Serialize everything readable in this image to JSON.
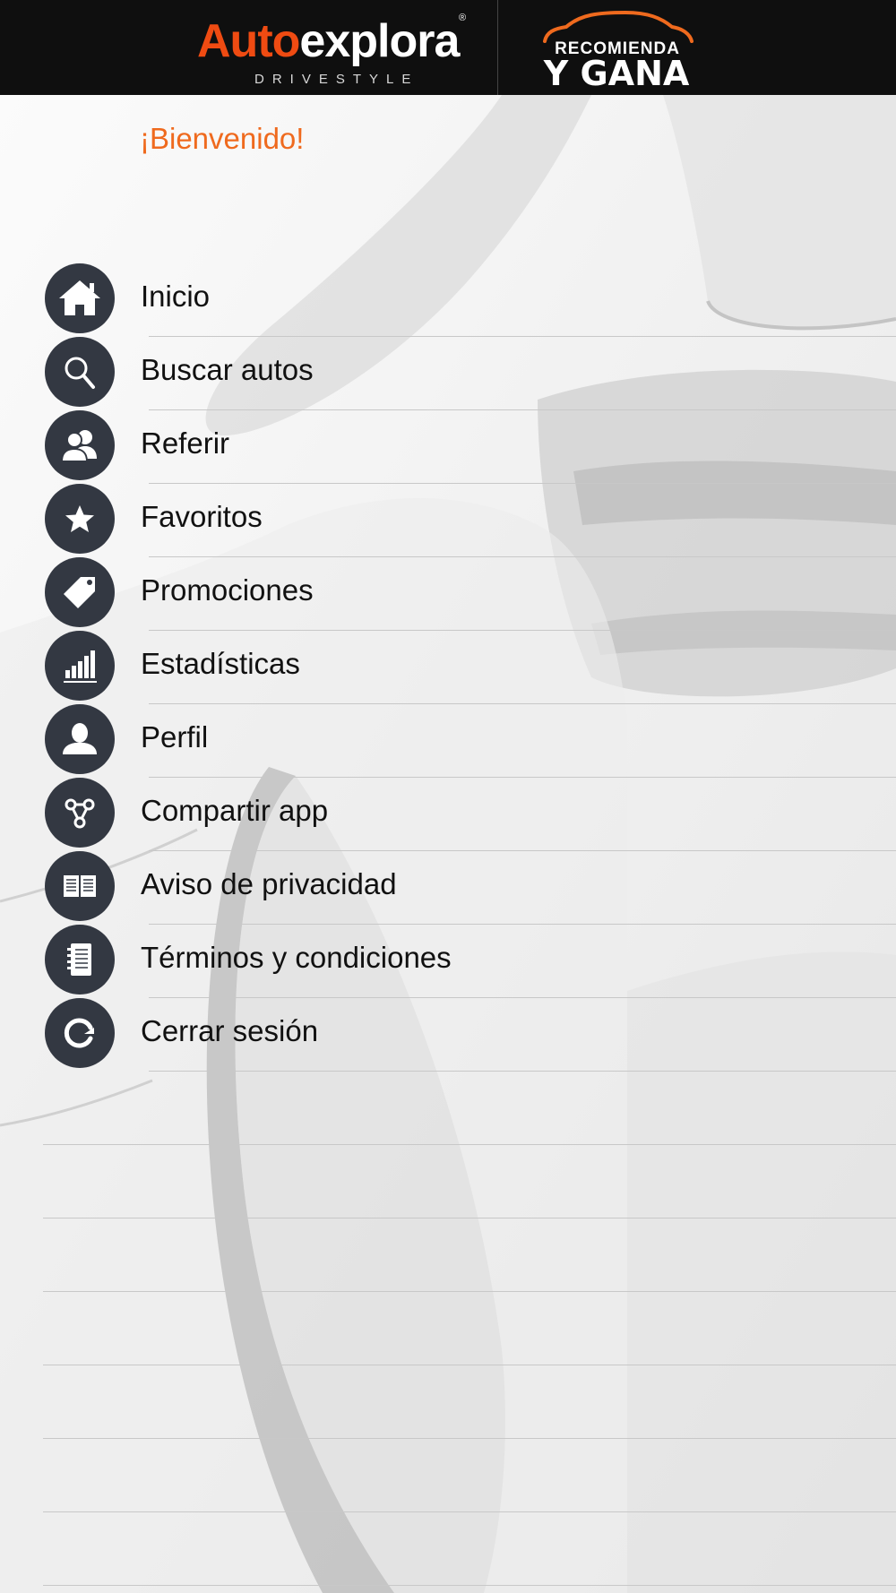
{
  "header": {
    "brand_part1": "Auto",
    "brand_part2": "explora",
    "brand_registered": "®",
    "brand_tagline": "DRIVESTYLE",
    "campaign_line1": "RECOMIENDA",
    "campaign_line2": "Y GANA",
    "background_color": "#0f0f0f",
    "accent_color": "#ef4b12"
  },
  "welcome": {
    "text": "¡Bienvenido!",
    "color": "#ef6a1e"
  },
  "menu": {
    "icon_color": "#333842",
    "items": [
      {
        "label": "Inicio",
        "icon": "home-icon"
      },
      {
        "label": "Buscar autos",
        "icon": "search-icon"
      },
      {
        "label": "Referir",
        "icon": "users-icon"
      },
      {
        "label": "Favoritos",
        "icon": "star-icon"
      },
      {
        "label": "Promociones",
        "icon": "tag-icon"
      },
      {
        "label": "Estadísticas",
        "icon": "bar-chart-icon"
      },
      {
        "label": "Perfil",
        "icon": "user-icon"
      },
      {
        "label": "Compartir app",
        "icon": "share-icon"
      },
      {
        "label": "Aviso de privacidad",
        "icon": "book-icon"
      },
      {
        "label": "Términos y condiciones",
        "icon": "notebook-icon"
      },
      {
        "label": "Cerrar sesión",
        "icon": "logout-icon"
      }
    ]
  }
}
